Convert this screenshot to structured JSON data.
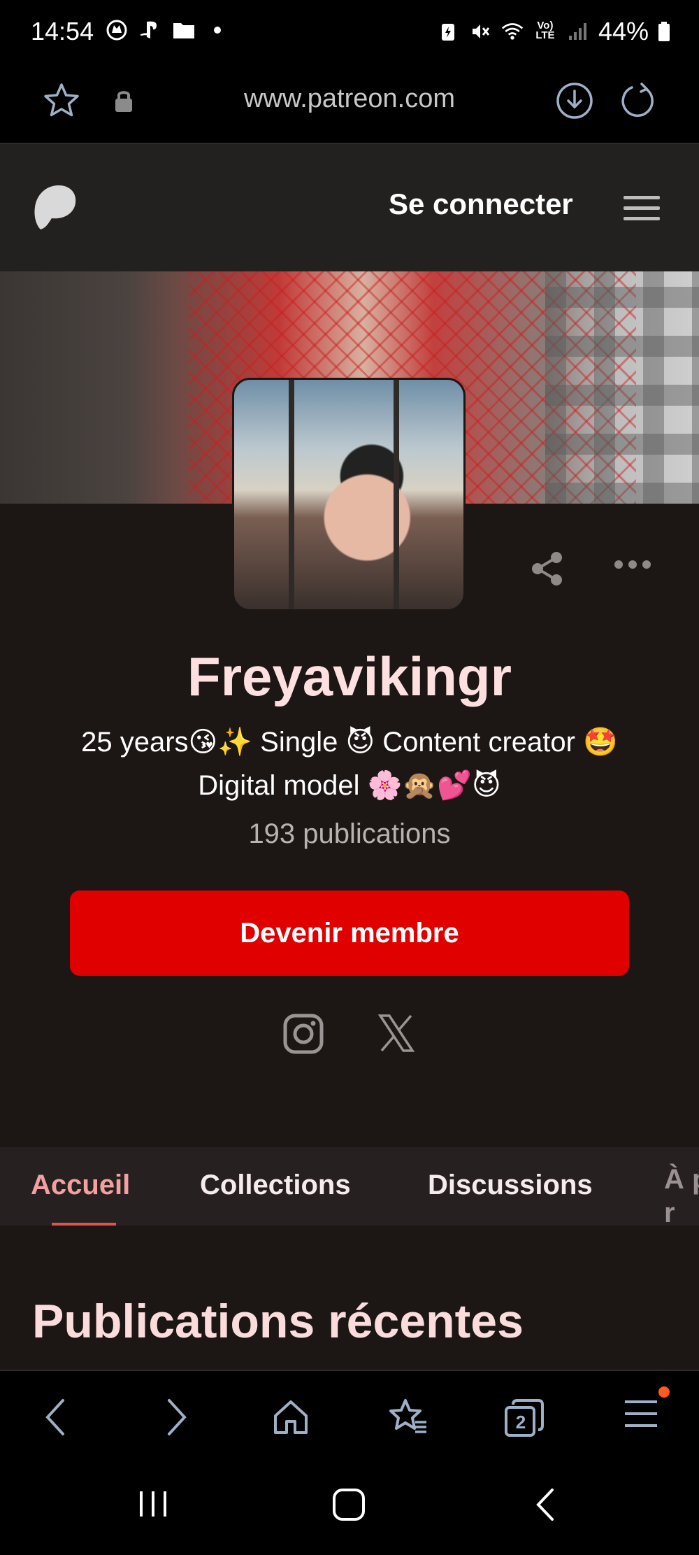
{
  "status_bar": {
    "time": "14:54",
    "battery_percent": "44%",
    "network": "Vo) LTE"
  },
  "browser": {
    "url": "www.patreon.com",
    "tab_count": "2"
  },
  "patreon_header": {
    "login_label": "Se connecter"
  },
  "profile": {
    "name": "Freyavikingr",
    "bio_line1": "25 years😘✨ Single 😈 Content creator 🤩",
    "bio_line2": "Digital model 🌸🙊💕😈",
    "publications": "193 publications",
    "join_label": "Devenir membre"
  },
  "tabs": [
    {
      "label": "Accueil",
      "active": true
    },
    {
      "label": "Collections",
      "active": false
    },
    {
      "label": "Discussions",
      "active": false
    },
    {
      "label": "À pr",
      "active": false
    }
  ],
  "recent": {
    "title": "Publications récentes"
  },
  "colors": {
    "join_button": "#e10000",
    "name_text": "#fde0df",
    "tab_active": "#f2a0a0",
    "background": "#1c1615"
  }
}
